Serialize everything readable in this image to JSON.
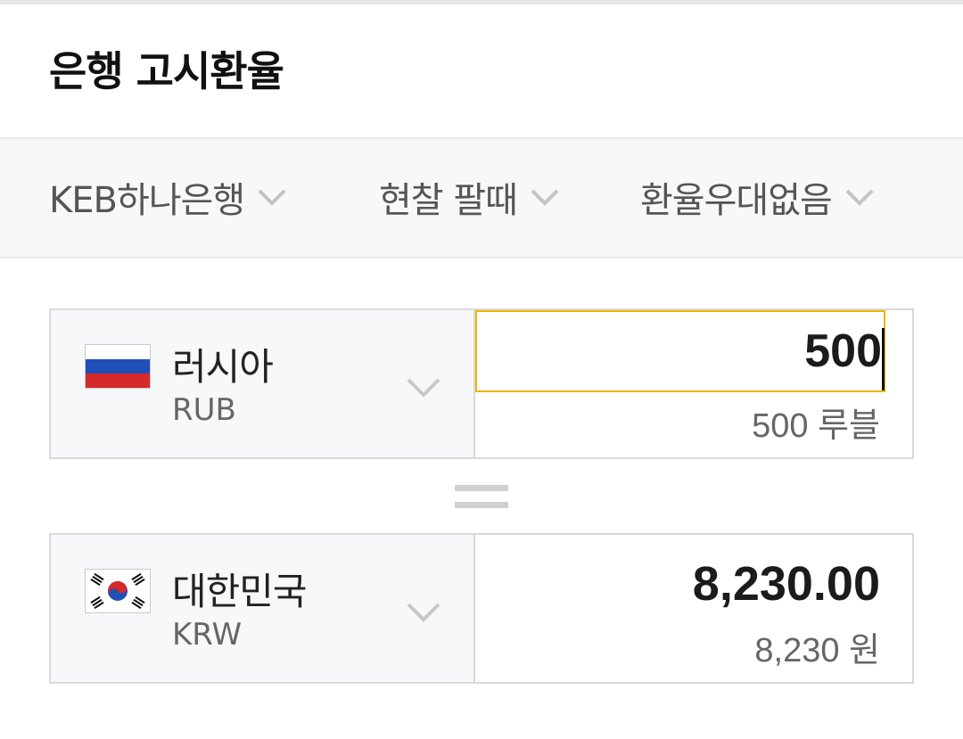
{
  "header": {
    "title": "은행 고시환율"
  },
  "filters": [
    {
      "label": "KEB하나은행"
    },
    {
      "label": "현찰 팔때"
    },
    {
      "label": "환율우대없음"
    }
  ],
  "from": {
    "country": "러시아",
    "code": "RUB",
    "amount": "500",
    "amount_text": "500 루블"
  },
  "to": {
    "country": "대한민국",
    "code": "KRW",
    "amount": "8,230.00",
    "amount_text": "8,230 원"
  },
  "colors": {
    "focus_border": "#f0b400",
    "panel_bg": "#f7f8fa"
  },
  "icons": {
    "dropdown": "chevron-down-icon",
    "equals": "equals-icon"
  }
}
